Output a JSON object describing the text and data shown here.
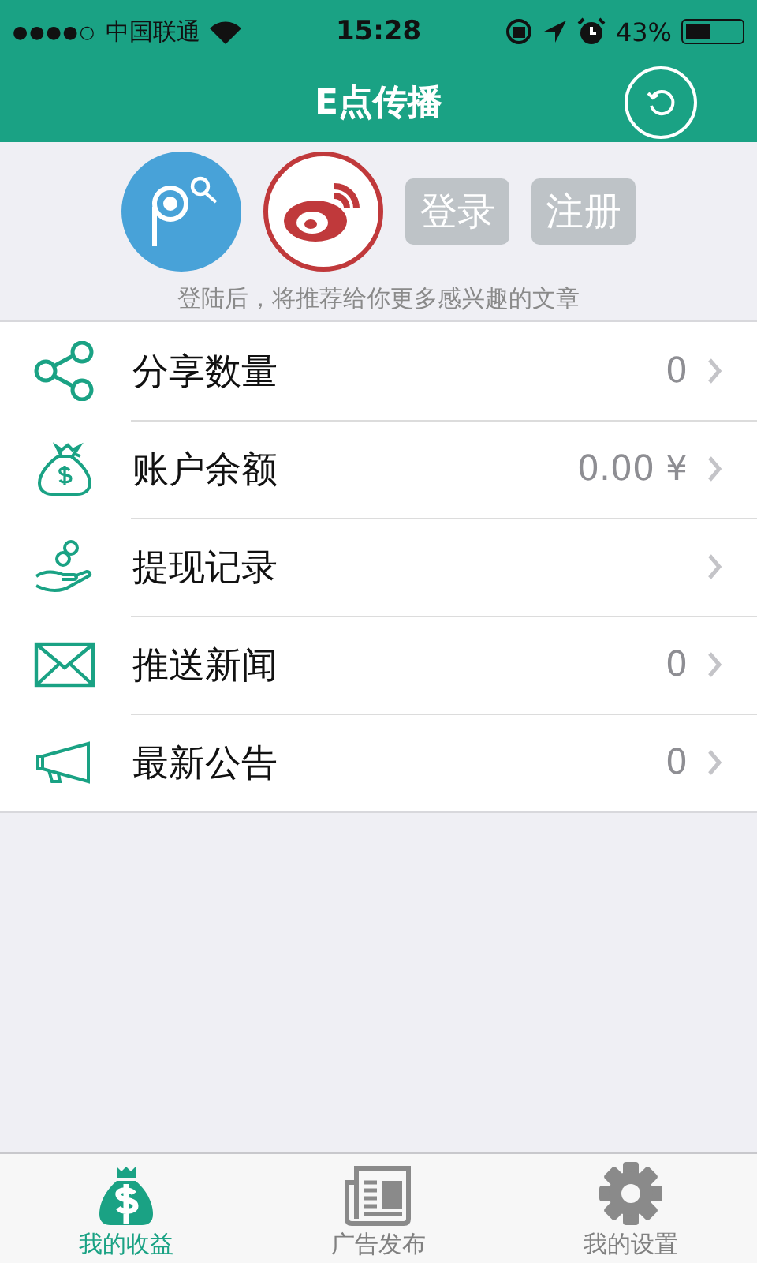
{
  "status_bar": {
    "signal_dots": "●●●●○",
    "carrier": "中国联通",
    "time": "15:28",
    "battery": "43%"
  },
  "header": {
    "title": "E点传播"
  },
  "login": {
    "buttons": [
      {
        "label": "登录"
      },
      {
        "label": "注册"
      }
    ],
    "hint": "登陆后，将推荐给你更多感兴趣的文章"
  },
  "menu": [
    {
      "label": "分享数量",
      "value": "0"
    },
    {
      "label": "账户余额",
      "value": "0.00 ¥"
    },
    {
      "label": "提现记录"
    },
    {
      "label": "推送新闻",
      "value": "0"
    },
    {
      "label": "最新公告",
      "value": "0"
    }
  ],
  "tab_bar": [
    {
      "label": "我的收益",
      "selected": true
    },
    {
      "label": "广告发布",
      "selected": false
    },
    {
      "label": "我的设置",
      "selected": false
    }
  ]
}
